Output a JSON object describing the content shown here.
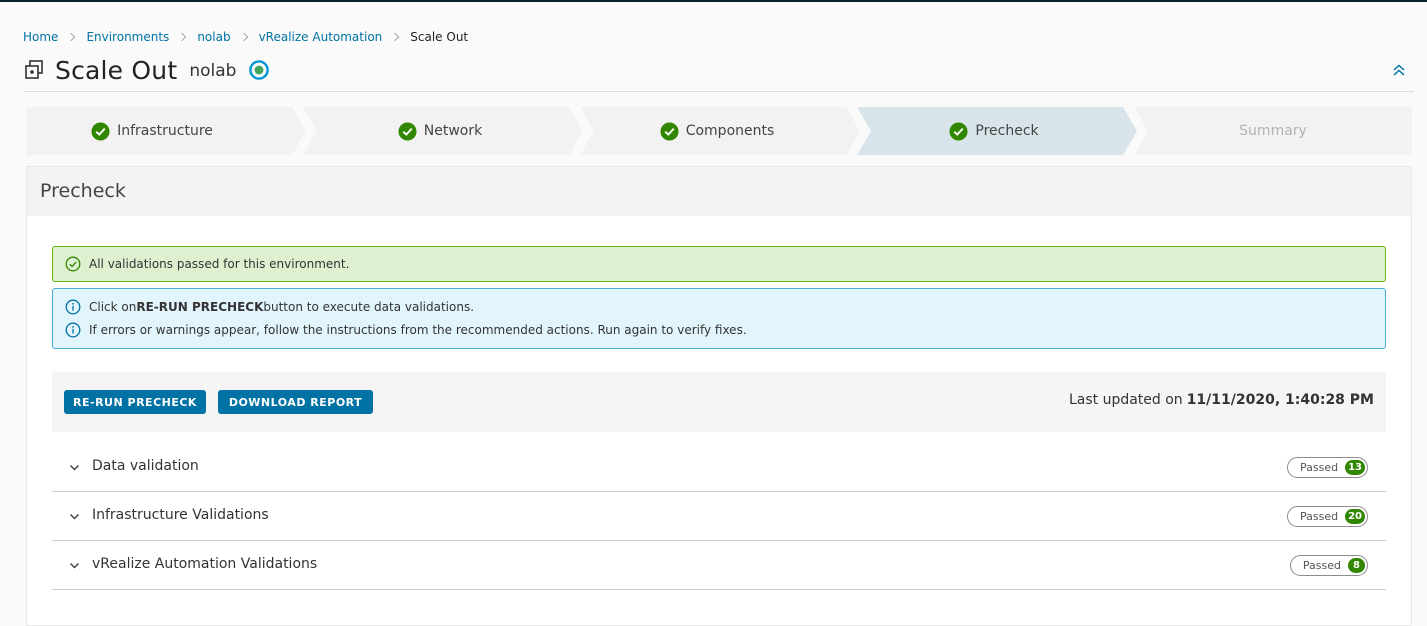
{
  "breadcrumb": {
    "items": [
      "Home",
      "Environments",
      "nolab",
      "vRealize Automation"
    ],
    "current": "Scale Out"
  },
  "header": {
    "title": "Scale Out",
    "environment": "nolab"
  },
  "stepper": {
    "steps": [
      {
        "label": "Infrastructure",
        "state": "done"
      },
      {
        "label": "Network",
        "state": "done"
      },
      {
        "label": "Components",
        "state": "done"
      },
      {
        "label": "Precheck",
        "state": "active"
      },
      {
        "label": "Summary",
        "state": "upcoming"
      }
    ]
  },
  "panel": {
    "title": "Precheck"
  },
  "alerts": {
    "success": "All validations passed for this environment.",
    "info1_prefix": "Click on ",
    "info1_bold": "RE-RUN PRECHECK",
    "info1_suffix": " button to execute data validations.",
    "info2": "If errors or warnings appear, follow the instructions from the recommended actions. Run again to verify fixes."
  },
  "actions": {
    "rerun_label": "RE-RUN PRECHECK",
    "download_label": "DOWNLOAD REPORT",
    "last_updated_label": "Last updated on",
    "last_updated_value": "11/11/2020, 1:40:28 PM"
  },
  "validations": [
    {
      "label": "Data validation",
      "status": "Passed",
      "count": "13"
    },
    {
      "label": "Infrastructure Validations",
      "status": "Passed",
      "count": "20"
    },
    {
      "label": "vRealize Automation Validations",
      "status": "Passed",
      "count": "8"
    }
  ],
  "colors": {
    "accent": "#0072a3",
    "success": "#318700",
    "success_bg": "#dff0d0",
    "info_bg": "#e3f5fc",
    "step_bg": "#f2f2f2",
    "step_active_bg": "#d9e4ea"
  }
}
